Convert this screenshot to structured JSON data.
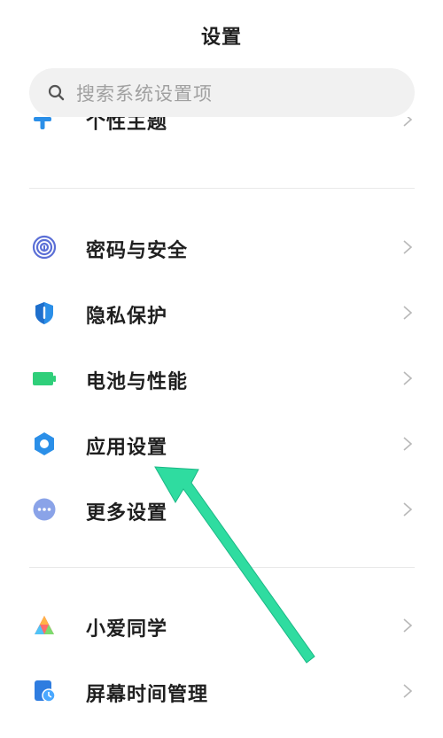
{
  "header": {
    "title": "设置"
  },
  "search": {
    "placeholder": "搜索系统设置项",
    "icon": "search-icon"
  },
  "cut_item": {
    "label": "个性主题",
    "icon": "theme-icon"
  },
  "group1": [
    {
      "id": "password",
      "label": "密码与安全",
      "icon": "fingerprint-icon",
      "color": "#5b6fd6"
    },
    {
      "id": "privacy",
      "label": "隐私保护",
      "icon": "privacy-shield-icon",
      "color": "#2b8fe8"
    },
    {
      "id": "battery",
      "label": "电池与性能",
      "icon": "battery-icon",
      "color": "#2fcf7a"
    },
    {
      "id": "apps",
      "label": "应用设置",
      "icon": "gear-icon",
      "color": "#2b8fe8"
    },
    {
      "id": "more",
      "label": "更多设置",
      "icon": "more-dots-icon",
      "color": "#8aa3e8"
    }
  ],
  "group2": [
    {
      "id": "xiaoai",
      "label": "小爱同学",
      "icon": "xiaoai-icon",
      "color": "#ff6b6b"
    },
    {
      "id": "screentime",
      "label": "屏幕时间管理",
      "icon": "hourglass-icon",
      "color": "#2f7de0"
    }
  ],
  "annotation": {
    "type": "arrow",
    "color": "#2fdca0"
  }
}
